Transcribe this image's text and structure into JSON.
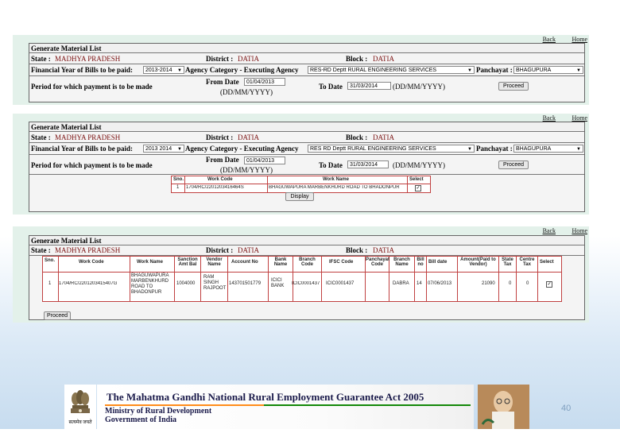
{
  "links": {
    "back": "Back",
    "home": "Home"
  },
  "panel1": {
    "title": "Generate Material List",
    "state_label": "State :",
    "state": "MADHYA PRADESH",
    "district_label": "District :",
    "district": "DATIA",
    "block_label": "Block :",
    "block": "DATIA",
    "fy_label": "Financial Year of Bills to be paid:",
    "fy": "2013-2014",
    "agency_label": "Agency Category - Executing Agency",
    "agency": "RES-RD Deptt RURAL ENGINEERING SERVICES",
    "panchayat_label": "Panchayat :",
    "panchayat": "BHAGUPURA",
    "period_label": "Period for which payment is to be made",
    "from_label": "From Date",
    "from": "01/04/2013",
    "to_label": "To Date",
    "to": "31/03/2014",
    "fmt": "(DD/MM/YYYY)",
    "proceed": "Proceed"
  },
  "panel2": {
    "title": "Generate Material List",
    "state_label": "State :",
    "state": "MADHYA PRADESH",
    "district_label": "District :",
    "district": "DATIA",
    "block_label": "Block :",
    "block": "DATIA",
    "fy_label": "Financial Year of Bills to be paid:",
    "fy": "2013 2014",
    "agency_label": "Agency Category - Executing Agency",
    "agency": "RES RD Deptt RURAL ENGINEERING SERVICES",
    "panchayat_label": "Panchayat :",
    "panchayat": "BHAGUPURA",
    "period_label": "Period for which payment is to be made",
    "from_label": "From Date",
    "from": "01/04/2013",
    "to_label": "To Date",
    "to": "31/03/2014",
    "fmt": "(DD/MM/YYYY)",
    "proceed": "Proceed",
    "table_headers": [
      "Sno.",
      "Work Code",
      "Work Name",
      "Select"
    ],
    "row": {
      "sno": "1",
      "code": "1704/RC/2201203416464S",
      "name": "BHAGUWAPURA MARBENKHURD ROAD TO BHADONPUR"
    },
    "display": "Display"
  },
  "panel3": {
    "title": "Generate Material List",
    "state_label": "State :",
    "state": "MADHYA PRADESH",
    "district_label": "District :",
    "district": "DATIA",
    "block_label": "Block :",
    "block": "DATIA",
    "headers": [
      "Sno.",
      "Work Code",
      "Work Name",
      "Sanction Amt Bal",
      "Vendor Name",
      "Account No",
      "Bank Name",
      "Branch Code",
      "IFSC Code",
      "Panchayat Code",
      "Branch Name",
      "Bill no",
      "Bill date",
      "Amount(Paid to Vendor)",
      "State Tax",
      "Centre Tax",
      "Select"
    ],
    "row": {
      "sno": "1",
      "code": "1704/RC/2201203415407G",
      "name": "BHAGUWAPURA MARBENKHURD ROAD TO BHADONPUR",
      "sanction": "1004000",
      "vendor": "RAM SINGH RAJPOOT",
      "account": "143701501779",
      "bank": "ICICI BANK",
      "branch_code": "ICIC0001437",
      "ifsc": "ICIC0001437",
      "branch_name": "DABRA",
      "bill_no": "14",
      "bill_date": "07/06/2013",
      "amount": "21090",
      "state_tax": "0",
      "centre_tax": "0"
    },
    "proceed": "Proceed"
  },
  "footer": {
    "title": "The Mahatma Gandhi National Rural Employment Guarantee Act 2005",
    "ministry": "Ministry of Rural Development",
    "govt": "Government of India",
    "emblem_caption": "सत्यमेव जयते"
  },
  "page_number": "40",
  "colors": {
    "panel_bg": "#e3f1ea",
    "value_red": "#7a1010",
    "grid_border": "#c04040",
    "slide_bottom": "#c7dcef"
  }
}
